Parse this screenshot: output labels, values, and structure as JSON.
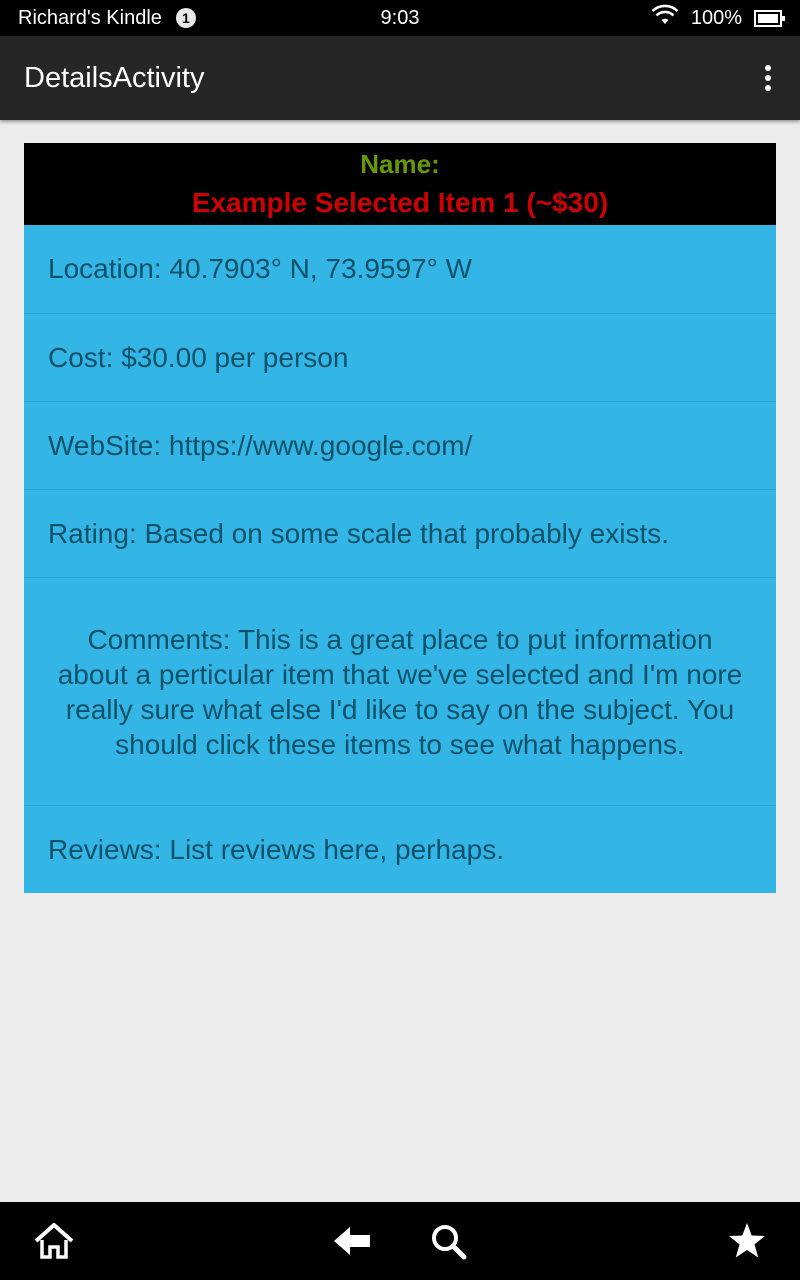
{
  "status_bar": {
    "device_name": "Richard's Kindle",
    "notification_count": "1",
    "time": "9:03",
    "battery": "100%"
  },
  "action_bar": {
    "title": "DetailsActivity"
  },
  "details": {
    "name_label": "Name:",
    "item_name": "Example Selected Item 1 (~$30)",
    "location": "Location: 40.7903° N, 73.9597° W",
    "cost": "Cost: $30.00 per person",
    "website": "WebSite: https://www.google.com/",
    "rating": "Rating: Based on some scale that probably exists.",
    "comments": "Comments: This is a great place to put information about a perticular item that we've selected and I'm nore really sure what else I'd like to say on the subject. You should click these items to see what happens.",
    "reviews": "Reviews: List reviews here, perhaps."
  },
  "colors": {
    "name_label": "#669900",
    "item_name": "#cc0000",
    "row_background": "#33b5e5",
    "row_text": "#0b526a",
    "header_background": "#000000",
    "action_bar": "#262626",
    "page_background": "#ececec"
  },
  "bottom_nav": {
    "icons": [
      "home-icon",
      "back-icon",
      "search-icon",
      "favorites-star-icon"
    ]
  }
}
